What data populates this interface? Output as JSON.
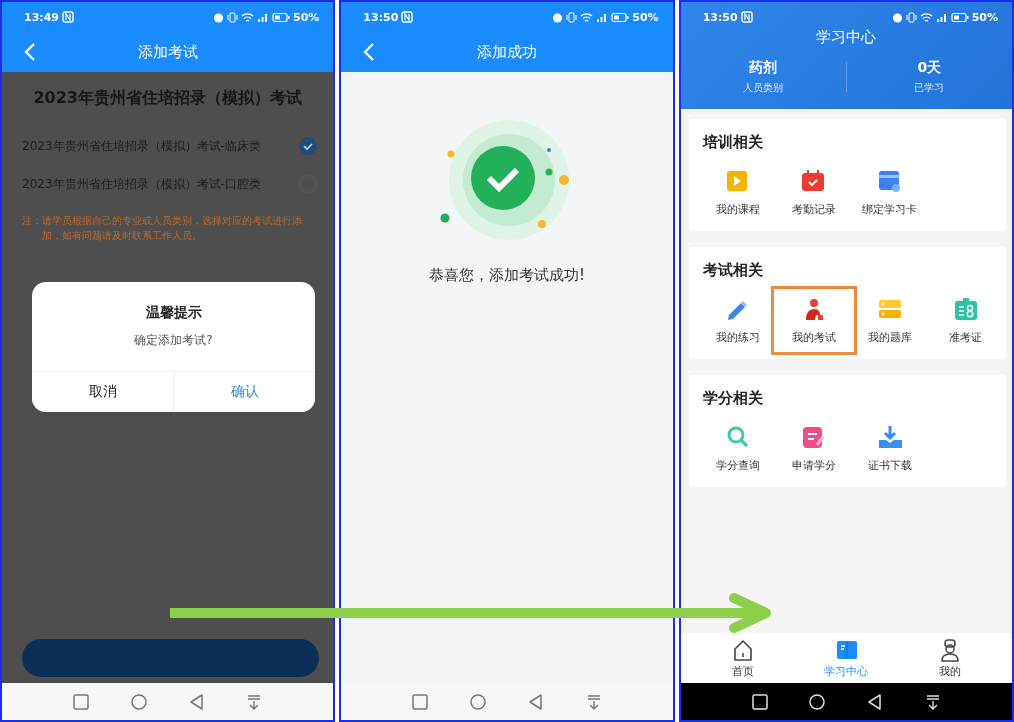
{
  "screens": [
    {
      "kind": "add_exam",
      "status": {
        "time": "13:49",
        "battery": "50%"
      },
      "title": "添加考试",
      "exam_title": "2023年贵州省住培招录（模拟）考试",
      "options": [
        {
          "label": "2023年贵州省住培招录（模拟）考试-临床类",
          "selected": true
        },
        {
          "label": "2023年贵州省住培招录（模拟）考试-口腔类",
          "selected": false
        }
      ],
      "note_label": "注：",
      "note": "请学员根据自己的专业或人员类别，选择对应的考试进行添加，如有问题请及时联系工作人员。",
      "dialog": {
        "title": "温馨提示",
        "message": "确定添加考试?",
        "buttons": [
          {
            "label": "取消",
            "kind": "cancel"
          },
          {
            "label": "确认",
            "kind": "confirm"
          }
        ]
      }
    },
    {
      "kind": "success",
      "status": {
        "time": "13:50",
        "battery": "50%"
      },
      "title": "添加成功",
      "message": "恭喜您，添加考试成功!"
    },
    {
      "kind": "learning_center",
      "status": {
        "time": "13:50",
        "battery": "50%"
      },
      "title": "学习中心",
      "stats": [
        {
          "value": "药剂",
          "label": "人员类别"
        },
        {
          "value": "0天",
          "label": "已学习"
        }
      ],
      "sections": [
        {
          "title": "培训相关",
          "items": [
            {
              "label": "我的课程",
              "highlighted": false
            },
            {
              "label": "考勤记录",
              "highlighted": false
            },
            {
              "label": "绑定学习卡",
              "highlighted": false
            }
          ]
        },
        {
          "title": "考试相关",
          "items": [
            {
              "label": "我的练习",
              "highlighted": false
            },
            {
              "label": "我的考试",
              "highlighted": true
            },
            {
              "label": "我的题库",
              "highlighted": false
            },
            {
              "label": "准考证",
              "highlighted": false
            }
          ]
        },
        {
          "title": "学分相关",
          "items": [
            {
              "label": "学分查询",
              "highlighted": false
            },
            {
              "label": "申请学分",
              "highlighted": false
            },
            {
              "label": "证书下载",
              "highlighted": false
            }
          ]
        }
      ],
      "tabs": [
        {
          "label": "首页",
          "selected": false
        },
        {
          "label": "学习中心",
          "selected": true
        },
        {
          "label": "我的",
          "selected": false
        }
      ]
    }
  ]
}
